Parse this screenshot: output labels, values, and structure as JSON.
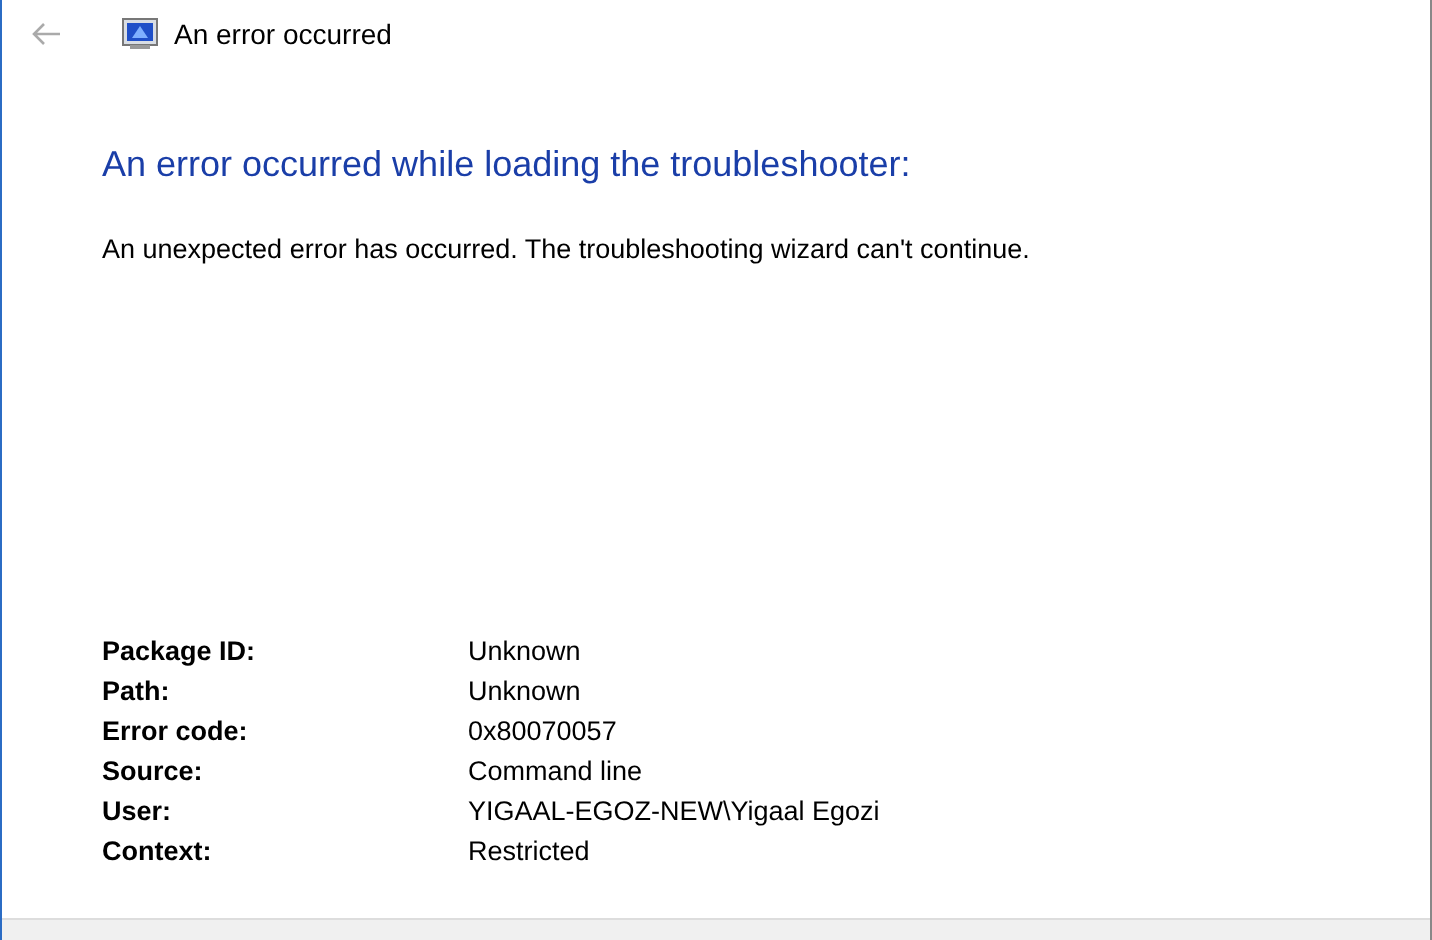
{
  "window": {
    "title": "An error occurred",
    "back_button": {
      "disabled": true
    }
  },
  "heading": "An error occurred while loading the troubleshooter:",
  "message": "An unexpected error has occurred. The troubleshooting wizard can't continue.",
  "details": [
    {
      "label": "Package ID:",
      "value": "Unknown"
    },
    {
      "label": "Path:",
      "value": "Unknown"
    },
    {
      "label": "Error code:",
      "value": "0x80070057"
    },
    {
      "label": "Source:",
      "value": "Command line"
    },
    {
      "label": "User:",
      "value": "YIGAAL-EGOZ-NEW\\Yigaal Egozi"
    },
    {
      "label": "Context:",
      "value": "Restricted"
    }
  ]
}
